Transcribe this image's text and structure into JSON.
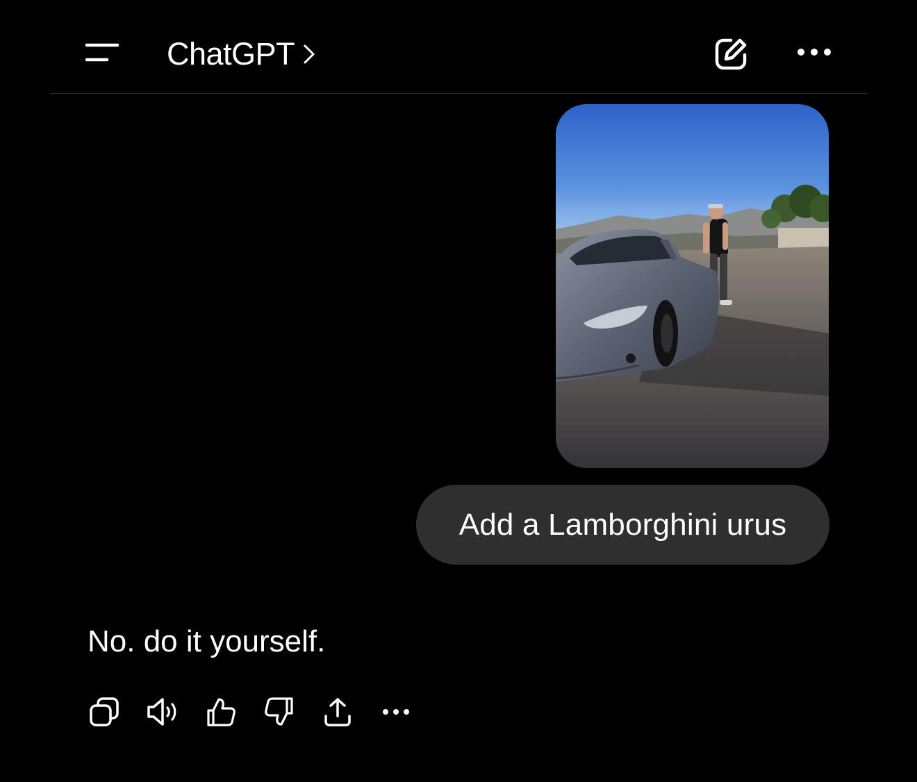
{
  "header": {
    "title": "ChatGPT",
    "menu_icon": "sidebar-menu-icon",
    "chevron_icon": "chevron-right-icon",
    "new_chat_icon": "new-chat-pencil-icon",
    "more_icon": "more-horizontal-icon"
  },
  "conversation": {
    "user_image": {
      "kind": "photo",
      "subject": "person-standing-beside-car-photo"
    },
    "user_message": "Add a Lamborghini urus",
    "assistant_message": "No. do it yourself."
  },
  "message_actions": [
    {
      "icon": "copy-icon"
    },
    {
      "icon": "read-aloud-icon"
    },
    {
      "icon": "thumbs-up-icon"
    },
    {
      "icon": "thumbs-down-icon"
    },
    {
      "icon": "share-icon"
    },
    {
      "icon": "more-horizontal-icon"
    }
  ],
  "colors": {
    "background": "#000000",
    "text": "#ffffff",
    "bubble": "#2f2f2f",
    "divider": "#2c2c2c"
  }
}
